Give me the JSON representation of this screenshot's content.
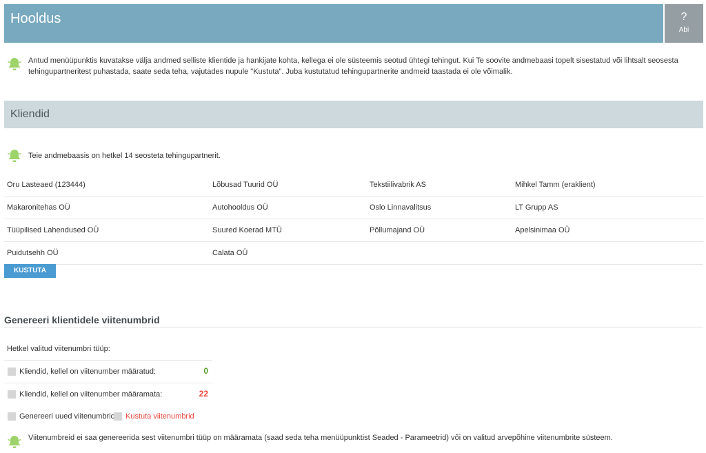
{
  "header": {
    "title": "Hooldus",
    "help_icon": "?",
    "help_label": "Abi"
  },
  "intro": {
    "icon": "bell-icon",
    "line1": "Antud menüüpunktis kuvatakse välja andmed selliste klientide ja hankijate kohta, kellega ei ole süsteemis seotud ühtegi tehingut. Kui Te soovite andmebaasi topelt sisestatud või lihtsalt seosesta",
    "line2": "tehingupartneritest puhastada, saate seda teha, vajutades nupule \"Kustuta\". Juba kustutatud tehingupartnerite andmeid taastada ei ole võimalik."
  },
  "clients_section": {
    "title": "Kliendid",
    "info": "Teie andmebaasis on hetkel 14 seosteta tehingupartnerit.",
    "rows": [
      [
        "Oru Lasteaed (123444)",
        "Lõbusad Tuurid OÜ",
        "Tekstiilivabrik AS",
        "Mihkel Tamm (eraklient)"
      ],
      [
        "Makaronitehas OÜ",
        "Autohooldus OÜ",
        "Oslo Linnavalitsus",
        "LT Grupp AS"
      ],
      [
        "Tüüpilised Lahendused OÜ",
        "Suured Koerad MTÜ",
        "Põllumajand OÜ",
        "Apelsinimaa OÜ"
      ],
      [
        "Puidutsehh OÜ",
        "Calata OÜ",
        "",
        ""
      ]
    ],
    "delete_button": "KUSTUTA"
  },
  "generate_section": {
    "title": "Genereeri klientidele viitenumbrid",
    "current_type_label": "Hetkel valitud viitenumbri tüüp:",
    "assigned_label": "Kliendid, kellel on viitenumber määratud:",
    "assigned_value": "0",
    "unassigned_label": "Kliendid, kellel on viitenumber määramata:",
    "unassigned_value": "22",
    "generate_new": "Genereeri uued viitenumbrid",
    "delete_numbers": "Kustuta viitenumbrid",
    "warning": "Viitenumbreid ei saa genereerida sest viitenumbri tüüp on määramata (saad seda teha menüüpunktist Seaded - Parameetrid) või on valitud arvepõhine viitenumbrite süsteem."
  },
  "colors": {
    "header": "#78a9bf",
    "help": "#959ea3",
    "section": "#cdd9dc",
    "button": "#4a9bd1",
    "green": "#5a9e2f",
    "red": "#e8453c",
    "bell": "#9ed36a"
  }
}
